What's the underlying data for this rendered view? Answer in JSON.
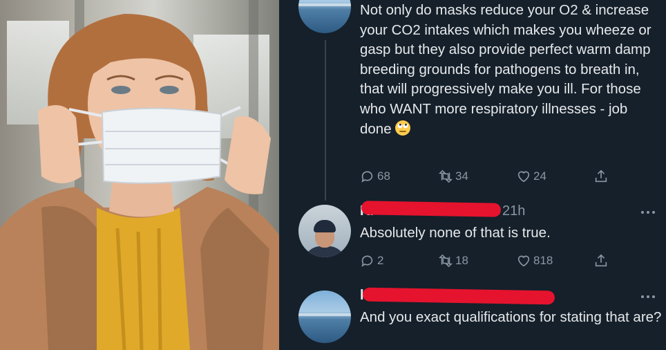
{
  "photo": {
    "icon": "woman-putting-on-face-mask-photo"
  },
  "tweets": [
    {
      "avatar": "seascape-avatar",
      "text": "Not only do masks reduce your O2 & increase your CO2 intakes which makes you wheeze or gasp but they also provide perfect warm damp breeding grounds for pathogens to breath in, that will progressively make you ill. For those who WANT more respiratory illnesses - job done",
      "emoji": "face-with-rolling-eyes",
      "replies": "68",
      "retweets": "34",
      "likes": "24"
    },
    {
      "avatar": "man-in-beanie-avatar",
      "handle": "K.",
      "time": "21h",
      "text": "Absolutely none of that is true.",
      "replies": "2",
      "retweets": "18",
      "likes": "818"
    },
    {
      "avatar": "seascape-avatar",
      "handle": "k",
      "time": "",
      "text": "And you exact qualifications for stating that are?"
    }
  ],
  "colors": {
    "background": "#15202b",
    "text": "#e7e9ea",
    "muted": "#8b98a5",
    "redaction": "#e5132d"
  }
}
